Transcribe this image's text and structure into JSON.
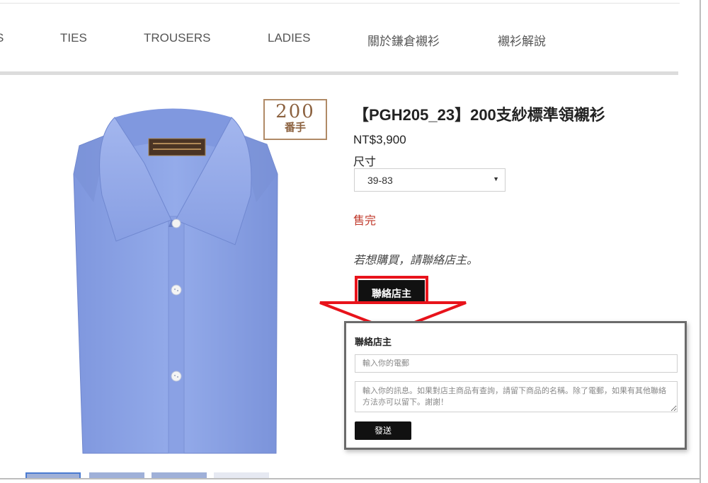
{
  "nav": {
    "items": [
      "S",
      "TIES",
      "TROUSERS",
      "LADIES",
      "關於鎌倉襯衫",
      "襯衫解說"
    ]
  },
  "badge": {
    "number": "200",
    "label": "番手"
  },
  "product": {
    "title": "【PGH205_23】200支紗標準領襯衫",
    "price": "NT$3,900",
    "size_label": "尺寸",
    "size_value": "39-83",
    "status": "售完",
    "note": "若想購買，請聯絡店主。",
    "contact_button": "聯絡店主"
  },
  "contact_form": {
    "title": "聯絡店主",
    "email_placeholder": "輸入你的電郵",
    "message_placeholder": "輸入你的訊息。如果對店主商品有查詢，請留下商品的名稱。除了電郵，如果有其他聯絡方法亦可以留下。謝謝！",
    "send_button": "發送"
  },
  "colors": {
    "shirt": "#8fa6e6",
    "sold_out": "#c0392b",
    "highlight": "#e8131b",
    "badge": "#b08a66"
  }
}
